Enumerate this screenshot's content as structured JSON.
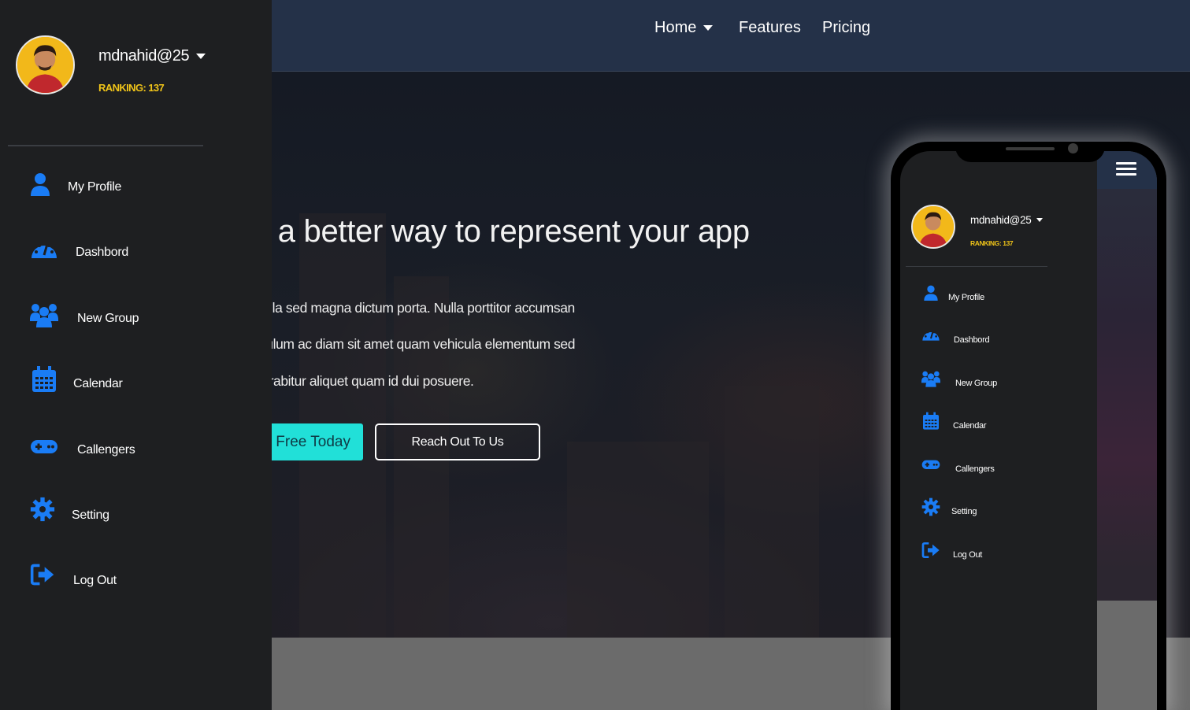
{
  "nav": {
    "home": "Home",
    "features": "Features",
    "pricing": "Pricing"
  },
  "hero": {
    "title": "e a better way to represent your app",
    "line1": "ligula sed magna dictum porta. Nulla porttitor accumsan",
    "line2": "tibulum ac diam sit amet quam vehicula elementum sed",
    "line3": "Curabitur aliquet quam id dui posuere.",
    "btn_free": "d Free Today",
    "btn_reach": "Reach Out To Us"
  },
  "user": {
    "name": "mdnahid@25",
    "ranking": "RANKING: 137"
  },
  "menu": [
    {
      "label": "My Profile",
      "icon": "user-icon"
    },
    {
      "label": "Dashbord",
      "icon": "dashboard-gauge-icon"
    },
    {
      "label": "New Group",
      "icon": "users-group-icon"
    },
    {
      "label": "Calendar",
      "icon": "calendar-icon"
    },
    {
      "label": "Callengers",
      "icon": "gamepad-icon"
    },
    {
      "label": "Setting",
      "icon": "gear-icon"
    },
    {
      "label": "Log Out",
      "icon": "sign-out-icon"
    }
  ],
  "colors": {
    "accent": "#1a7cf5",
    "ranking": "#f0c419",
    "cta": "#21e0d8",
    "navbar": "#243148",
    "sidebar": "#1e1f21"
  }
}
